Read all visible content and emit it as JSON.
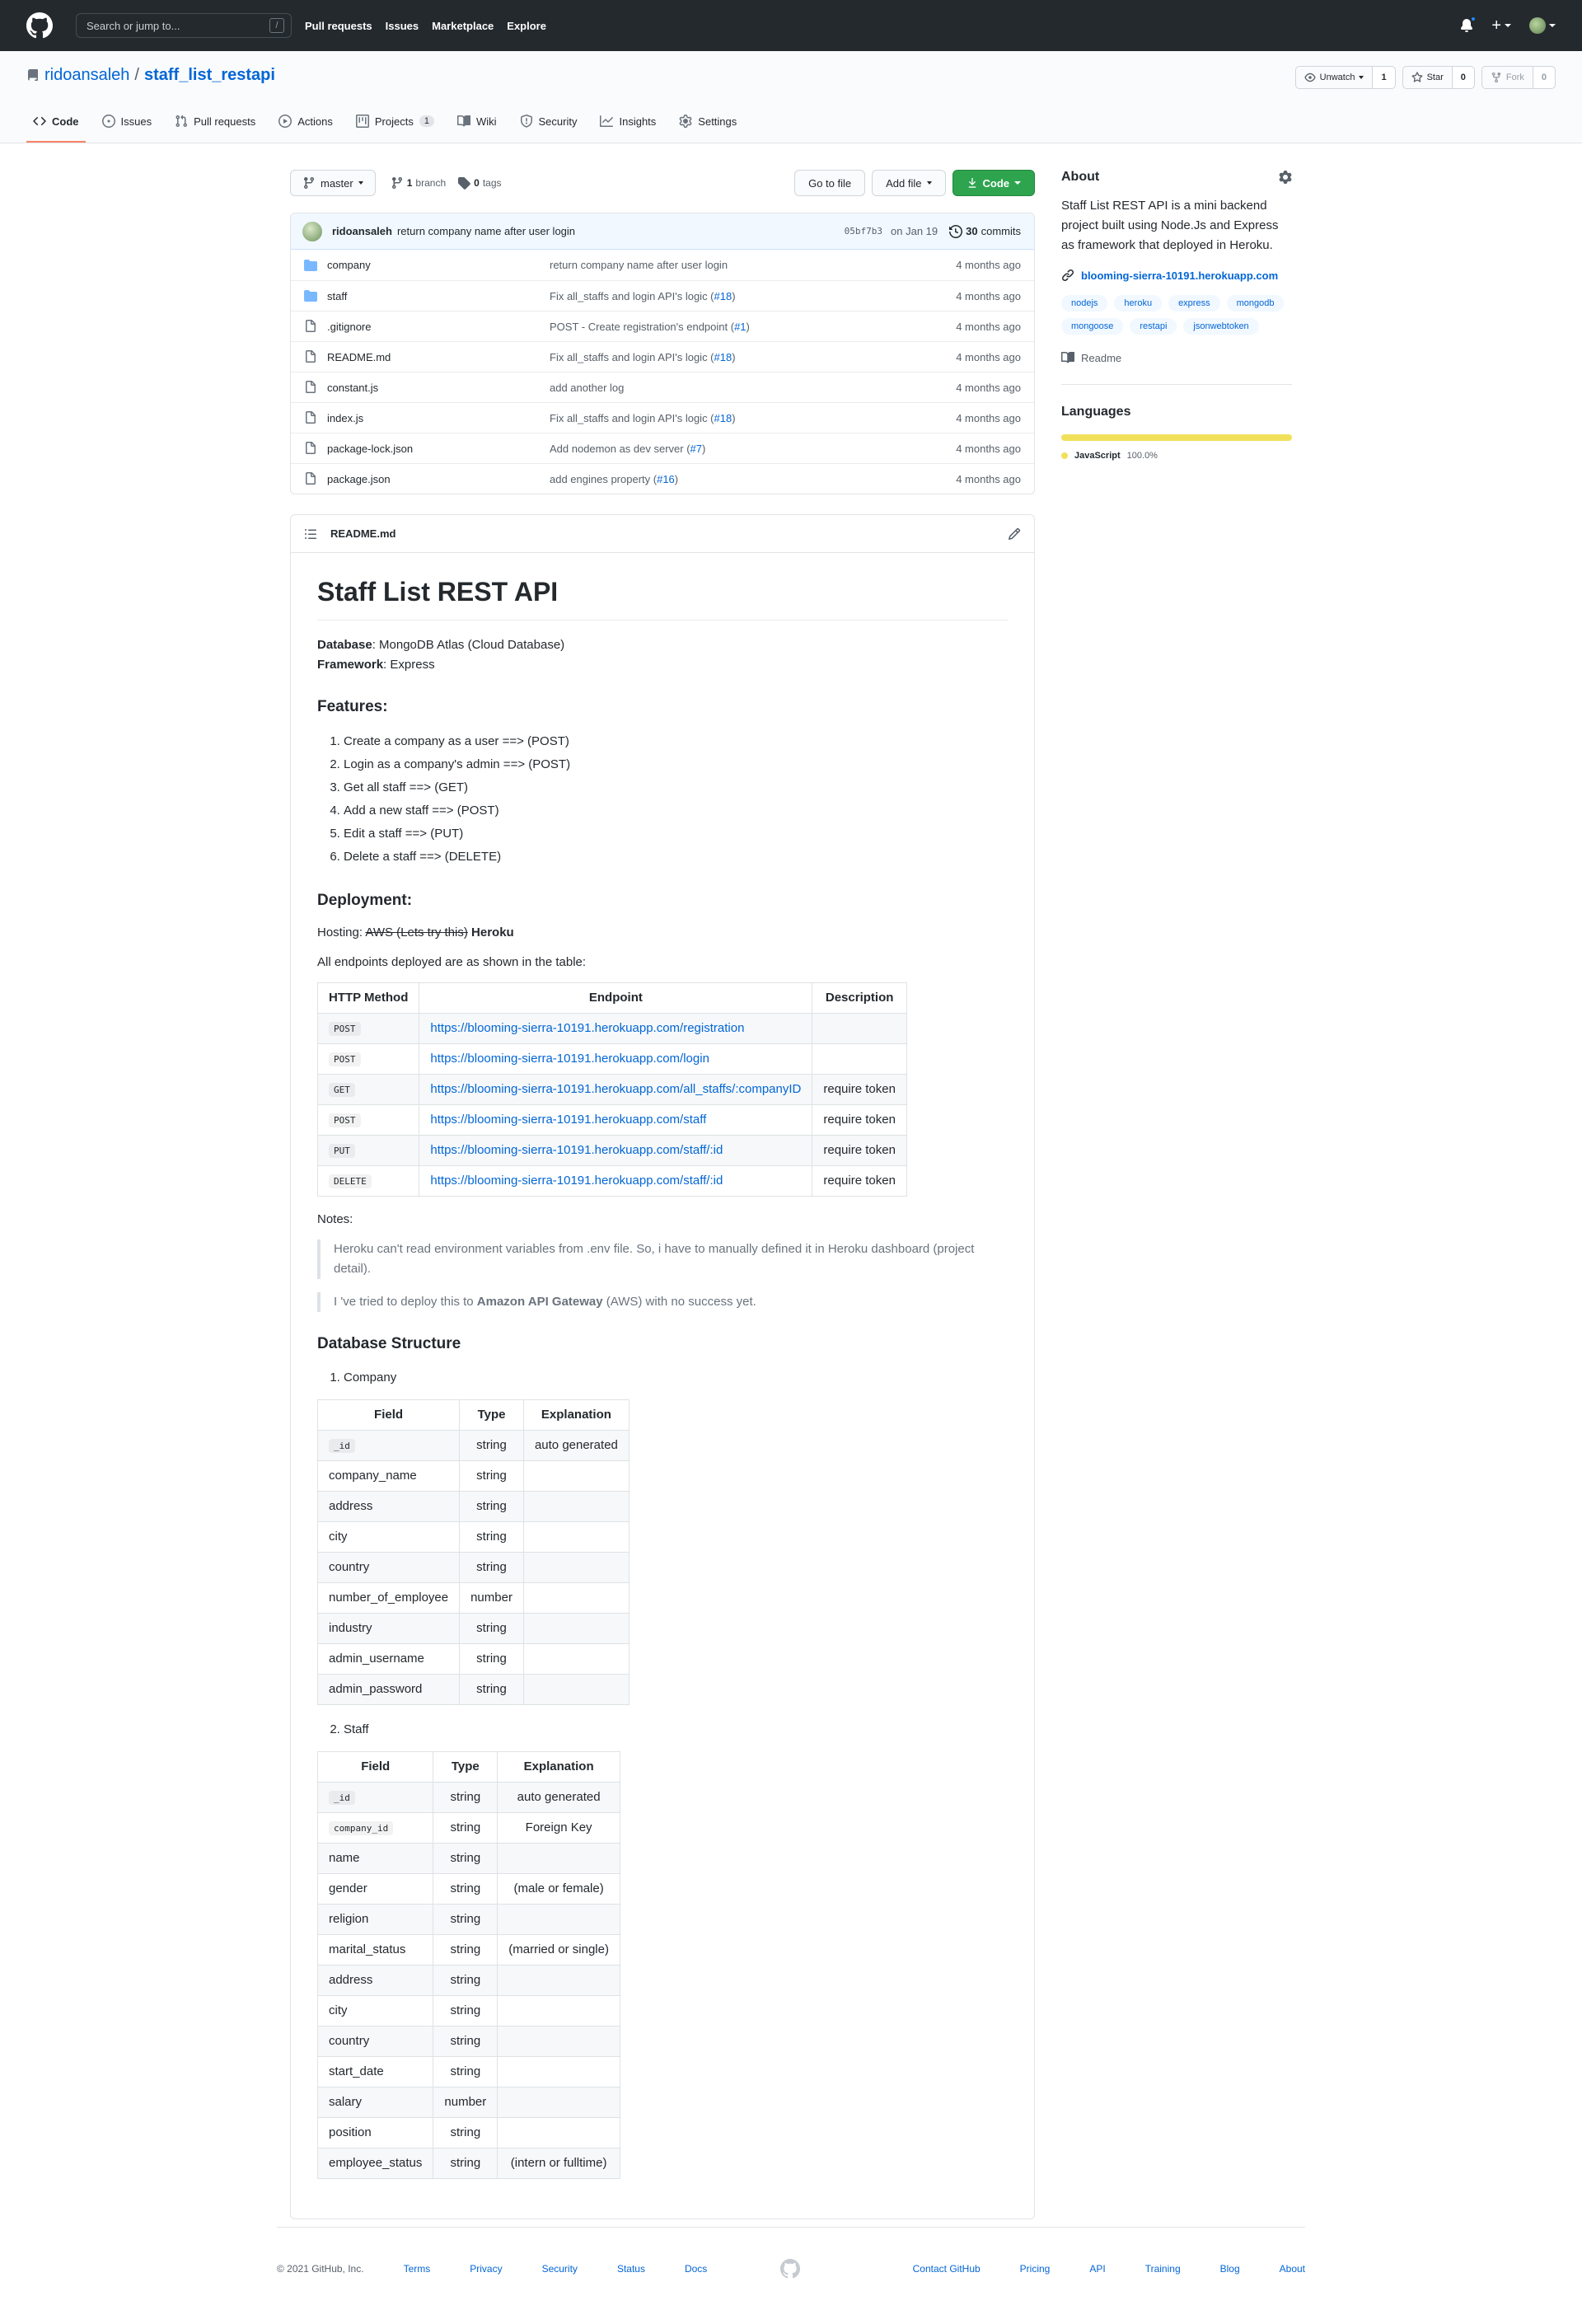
{
  "header": {
    "search_placeholder": "Search or jump to...",
    "slash": "/",
    "nav": [
      "Pull requests",
      "Issues",
      "Marketplace",
      "Explore"
    ]
  },
  "repo": {
    "owner": "ridoansaleh",
    "name": "staff_list_restapi",
    "watch_label": "Unwatch",
    "watch_count": "1",
    "star_label": "Star",
    "star_count": "0",
    "fork_label": "Fork",
    "fork_count": "0",
    "tabs": [
      {
        "label": "Code"
      },
      {
        "label": "Issues"
      },
      {
        "label": "Pull requests"
      },
      {
        "label": "Actions"
      },
      {
        "label": "Projects",
        "count": "1"
      },
      {
        "label": "Wiki"
      },
      {
        "label": "Security"
      },
      {
        "label": "Insights"
      },
      {
        "label": "Settings"
      }
    ]
  },
  "filebar": {
    "branch": "master",
    "branch_count": "1",
    "branch_text": "branch",
    "tag_count": "0",
    "tag_text": "tags",
    "go_to_file": "Go to file",
    "add_file": "Add file",
    "code": "Code"
  },
  "commit": {
    "author": "ridoansaleh",
    "message": "return company name after user login",
    "sha": "05bf7b3",
    "date": "on Jan 19",
    "count": "30",
    "count_text": "commits"
  },
  "files": [
    {
      "name": "company",
      "type": "dir",
      "msg": "return company name after user login",
      "pr": "",
      "age": "4 months ago"
    },
    {
      "name": "staff",
      "type": "dir",
      "msg": "Fix all_staffs and login API's logic (",
      "pr": "#18",
      "age": "4 months ago"
    },
    {
      "name": ".gitignore",
      "type": "file",
      "msg": "POST - Create registration's endpoint (",
      "pr": "#1",
      "age": "4 months ago"
    },
    {
      "name": "README.md",
      "type": "file",
      "msg": "Fix all_staffs and login API's logic (",
      "pr": "#18",
      "age": "4 months ago"
    },
    {
      "name": "constant.js",
      "type": "file",
      "msg": "add another log",
      "pr": "",
      "age": "4 months ago"
    },
    {
      "name": "index.js",
      "type": "file",
      "msg": "Fix all_staffs and login API's logic (",
      "pr": "#18",
      "age": "4 months ago"
    },
    {
      "name": "package-lock.json",
      "type": "file",
      "msg": "Add nodemon as dev server (",
      "pr": "#7",
      "age": "4 months ago"
    },
    {
      "name": "package.json",
      "type": "file",
      "msg": "add engines property (",
      "pr": "#16",
      "age": "4 months ago"
    }
  ],
  "readme": {
    "filename": "README.md",
    "title": "Staff List REST API",
    "db_label": "Database",
    "db_value": ": MongoDB Atlas (Cloud Database)",
    "fw_label": "Framework",
    "fw_value": ": Express",
    "features_title": "Features:",
    "features": [
      "Create a company as a user ==> (POST)",
      "Login as a company's admin ==> (POST)",
      "Get all staff ==> (GET)",
      "Add a new staff ==> (POST)",
      "Edit a staff ==> (PUT)",
      "Delete a staff ==> (DELETE)"
    ],
    "deploy_title": "Deployment:",
    "hosting_label": "Hosting: ",
    "hosting_strike": "AWS (Lets try this)",
    "hosting_value": "Heroku",
    "endpoints_intro": "All endpoints deployed are as shown in the table:",
    "endpoint_headers": [
      "HTTP Method",
      "Endpoint",
      "Description"
    ],
    "endpoints": [
      {
        "method": "POST",
        "url": "https://blooming-sierra-10191.herokuapp.com/registration",
        "desc": ""
      },
      {
        "method": "POST",
        "url": "https://blooming-sierra-10191.herokuapp.com/login",
        "desc": ""
      },
      {
        "method": "GET",
        "url": "https://blooming-sierra-10191.herokuapp.com/all_staffs/:companyID",
        "desc": "require token"
      },
      {
        "method": "POST",
        "url": "https://blooming-sierra-10191.herokuapp.com/staff",
        "desc": "require token"
      },
      {
        "method": "PUT",
        "url": "https://blooming-sierra-10191.herokuapp.com/staff/:id",
        "desc": "require token"
      },
      {
        "method": "DELETE",
        "url": "https://blooming-sierra-10191.herokuapp.com/staff/:id",
        "desc": "require token"
      }
    ],
    "notes_label": "Notes:",
    "note1": "Heroku can't read environment variables from .env file. So, i have to manually defined it in Heroku dashboard (project detail).",
    "note2_pre": "I 've tried to deploy this to ",
    "note2_bold": "Amazon API Gateway",
    "note2_post": " (AWS) with no success yet.",
    "db_struct_title": "Database Structure",
    "company_label": "Company",
    "staff_label": "Staff",
    "table_headers": [
      "Field",
      "Type",
      "Explanation"
    ],
    "company_fields": [
      {
        "field": "_id",
        "code": true,
        "type": "string",
        "exp": "auto generated"
      },
      {
        "field": "company_name",
        "code": false,
        "type": "string",
        "exp": ""
      },
      {
        "field": "address",
        "code": false,
        "type": "string",
        "exp": ""
      },
      {
        "field": "city",
        "code": false,
        "type": "string",
        "exp": ""
      },
      {
        "field": "country",
        "code": false,
        "type": "string",
        "exp": ""
      },
      {
        "field": "number_of_employee",
        "code": false,
        "type": "number",
        "exp": ""
      },
      {
        "field": "industry",
        "code": false,
        "type": "string",
        "exp": ""
      },
      {
        "field": "admin_username",
        "code": false,
        "type": "string",
        "exp": ""
      },
      {
        "field": "admin_password",
        "code": false,
        "type": "string",
        "exp": ""
      }
    ],
    "staff_fields": [
      {
        "field": "_id",
        "code": true,
        "type": "string",
        "exp": "auto generated"
      },
      {
        "field": "company_id",
        "code": true,
        "type": "string",
        "exp": "Foreign Key"
      },
      {
        "field": "name",
        "code": false,
        "type": "string",
        "exp": ""
      },
      {
        "field": "gender",
        "code": false,
        "type": "string",
        "exp": "(male or female)"
      },
      {
        "field": "religion",
        "code": false,
        "type": "string",
        "exp": ""
      },
      {
        "field": "marital_status",
        "code": false,
        "type": "string",
        "exp": "(married or single)"
      },
      {
        "field": "address",
        "code": false,
        "type": "string",
        "exp": ""
      },
      {
        "field": "city",
        "code": false,
        "type": "string",
        "exp": ""
      },
      {
        "field": "country",
        "code": false,
        "type": "string",
        "exp": ""
      },
      {
        "field": "start_date",
        "code": false,
        "type": "string",
        "exp": ""
      },
      {
        "field": "salary",
        "code": false,
        "type": "number",
        "exp": ""
      },
      {
        "field": "position",
        "code": false,
        "type": "string",
        "exp": ""
      },
      {
        "field": "employee_status",
        "code": false,
        "type": "string",
        "exp": "(intern or fulltime)"
      }
    ]
  },
  "sidebar": {
    "about_title": "About",
    "description": "Staff List REST API is a mini backend project built using Node.Js and Express as framework that deployed in Heroku.",
    "website": "blooming-sierra-10191.herokuapp.com",
    "topics": [
      "nodejs",
      "heroku",
      "express",
      "mongodb",
      "mongoose",
      "restapi",
      "jsonwebtoken"
    ],
    "readme_label": "Readme",
    "languages_title": "Languages",
    "language": "JavaScript",
    "language_pct": "100.0%",
    "language_color": "#f1e05a"
  },
  "footer": {
    "copyright": "© 2021 GitHub, Inc.",
    "left_links": [
      "Terms",
      "Privacy",
      "Security",
      "Status",
      "Docs"
    ],
    "right_links": [
      "Contact GitHub",
      "Pricing",
      "API",
      "Training",
      "Blog",
      "About"
    ]
  }
}
